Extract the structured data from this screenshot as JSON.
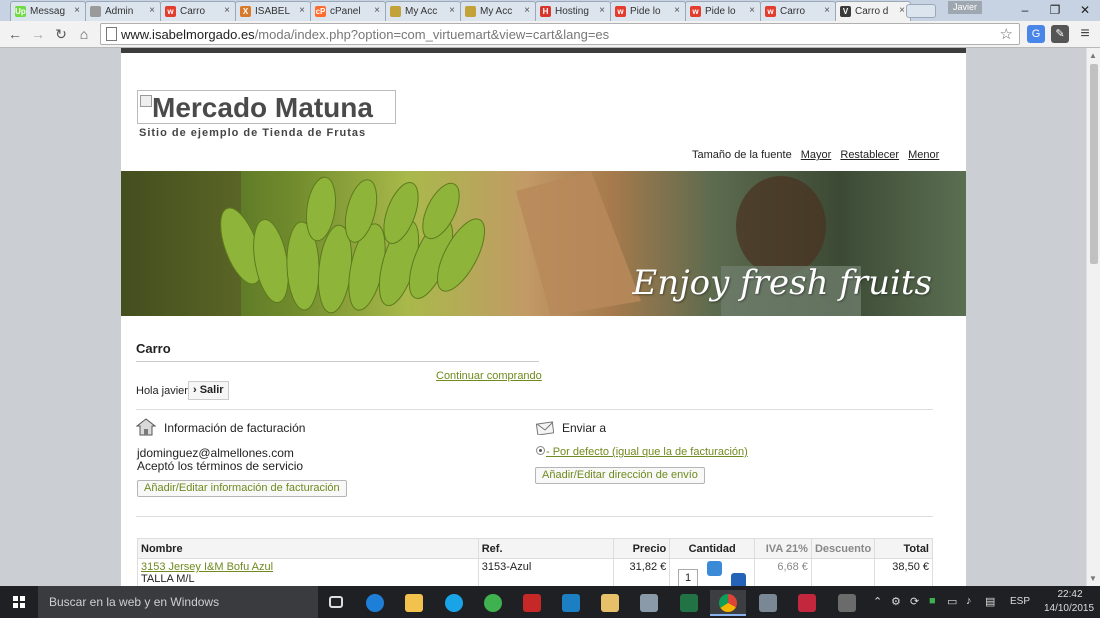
{
  "browser": {
    "tabs": [
      {
        "label": "Messag",
        "icon": "upwork-icon",
        "color": "#6fda44",
        "glyph": "Up"
      },
      {
        "label": "Admin",
        "icon": "admin-page-icon",
        "color": "#9a9a9a",
        "glyph": ""
      },
      {
        "label": "Carro",
        "icon": "store-icon",
        "color": "#e33d2d",
        "glyph": "w"
      },
      {
        "label": "ISABEL",
        "icon": "joomla-icon",
        "color": "#d97a2b",
        "glyph": "X"
      },
      {
        "label": "cPanel",
        "icon": "cpanel-icon",
        "color": "#ff6c2c",
        "glyph": "cP"
      },
      {
        "label": "My Acc",
        "icon": "account-icon",
        "color": "#c4a23a",
        "glyph": ""
      },
      {
        "label": "My Acc",
        "icon": "account-icon",
        "color": "#c4a23a",
        "glyph": ""
      },
      {
        "label": "Hosting",
        "icon": "hosting-icon",
        "color": "#d8362a",
        "glyph": "H"
      },
      {
        "label": "Pide lo",
        "icon": "store-icon",
        "color": "#e33d2d",
        "glyph": "w"
      },
      {
        "label": "Pide lo",
        "icon": "store-icon",
        "color": "#e33d2d",
        "glyph": "w"
      },
      {
        "label": "Carro",
        "icon": "store-icon",
        "color": "#e33d2d",
        "glyph": "w"
      },
      {
        "label": "Carro d",
        "icon": "virtuemart-icon",
        "color": "#3a3a3a",
        "glyph": "V"
      }
    ],
    "close_glyph": "×",
    "profile_name": "Javier",
    "url_host": "www.isabelmorgado.es",
    "url_path": "/moda/index.php?option=com_virtuemart&view=cart&lang=es"
  },
  "site": {
    "logo_alt": "Mercado Matuna",
    "slogan": "Sitio de ejemplo de Tienda de Frutas",
    "font_size_label": "Tamaño de la fuente",
    "font_bigger": "Mayor",
    "font_reset": "Restablecer",
    "font_smaller": "Menor",
    "banner_caption": "Enjoy fresh fruits"
  },
  "cart": {
    "title": "Carro",
    "continue_shopping": "Continuar comprando",
    "greeting": "Hola javier",
    "logout": "› Salir",
    "billing": {
      "title": "Información de facturación",
      "email": "jdominguez@almellones.com",
      "terms": "Aceptó los términos de servicio",
      "edit_button": "Añadir/Editar información de facturación"
    },
    "shipping": {
      "title": "Enviar a",
      "default_option": "- Por defecto (igual que la de facturación)",
      "edit_button": "Añadir/Editar dirección de envío"
    },
    "table": {
      "headers": {
        "name": "Nombre",
        "ref": "Ref.",
        "price": "Precio",
        "quantity": "Cantidad",
        "tax": "IVA 21%",
        "discount": "Descuento",
        "total": "Total"
      },
      "rows": [
        {
          "name": "3153 Jersey I&M Bofu Azul",
          "variant": "TALLA M/L",
          "ref": "3153-Azul",
          "price": "31,82 €",
          "quantity": "1",
          "tax": "6,68 €",
          "discount": "",
          "total": "38,50 €"
        }
      ]
    }
  },
  "taskbar": {
    "search_placeholder": "Buscar en la web y en Windows",
    "language": "ESP",
    "time": "22:42",
    "date": "14/10/2015"
  }
}
